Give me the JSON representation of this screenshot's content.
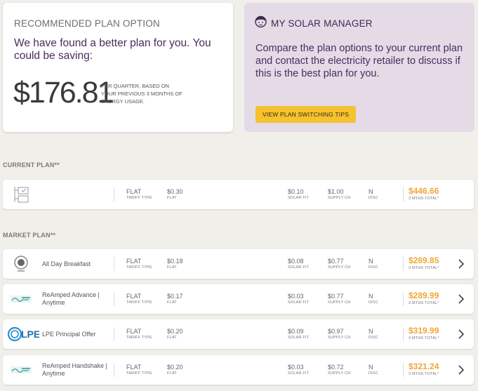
{
  "recommended": {
    "header": "RECOMMENDED PLAN OPTION",
    "message": "We have found a better plan for you. You could be saving:",
    "amount": "$176.81",
    "note": "PER QUARTER, BASED ON YOUR PREVIOUS 3 MONTHS OF ENERGY USAGE."
  },
  "solar_manager": {
    "header": "MY SOLAR MANAGER",
    "icon": "face-icon",
    "message": "Compare the plan options to your current plan and contact the electricity retailer to discuss if this is the best plan for you.",
    "button": "VIEW PLAN SWITCHING TIPS"
  },
  "labels": {
    "current_plan": "CURRENT PLAN**",
    "market_plan": "MARKET PLAN**",
    "tariff_type": "TARIFF TYPE",
    "flat": "FLAT",
    "solar_fit": "SOLAR FIT",
    "supply_ch": "SUPPLY CH",
    "disc": "DISC",
    "total": "3 MTHS TOTAL*"
  },
  "current_plan": {
    "name": "",
    "tariff": "FLAT",
    "rate": "$0.30",
    "solar_fit": "$0.10",
    "supply": "$1.00",
    "disc": "N",
    "total": "$446.66"
  },
  "market_plans": [
    {
      "name": "All Day Breakfast",
      "logo": "circle-logo",
      "tariff": "FLAT",
      "rate": "$0.18",
      "solar_fit": "$0.08",
      "supply": "$0.77",
      "disc": "N",
      "total": "$269.85"
    },
    {
      "name": "ReAmped Advance | Anytime",
      "logo": "reamped-logo",
      "tariff": "FLAT",
      "rate": "$0.17",
      "solar_fit": "$0.03",
      "supply": "$0.77",
      "disc": "N",
      "total": "$289.99"
    },
    {
      "name": "LPE Principal Offer",
      "logo": "lpe-logo",
      "logo_text": "LPE",
      "tariff": "FLAT",
      "rate": "$0.20",
      "solar_fit": "$0.09",
      "supply": "$0.97",
      "disc": "N",
      "total": "$319.99"
    },
    {
      "name": "ReAmped Handshake | Anytime",
      "logo": "reamped-logo",
      "tariff": "FLAT",
      "rate": "$0.20",
      "solar_fit": "$0.03",
      "supply": "$0.72",
      "disc": "N",
      "total": "$321.24"
    }
  ],
  "colors": {
    "accent_purple": "#4a2c5e",
    "button_yellow": "#f5c230",
    "price_orange": "#f0a63a",
    "solar_bg": "#e5dbe7"
  }
}
